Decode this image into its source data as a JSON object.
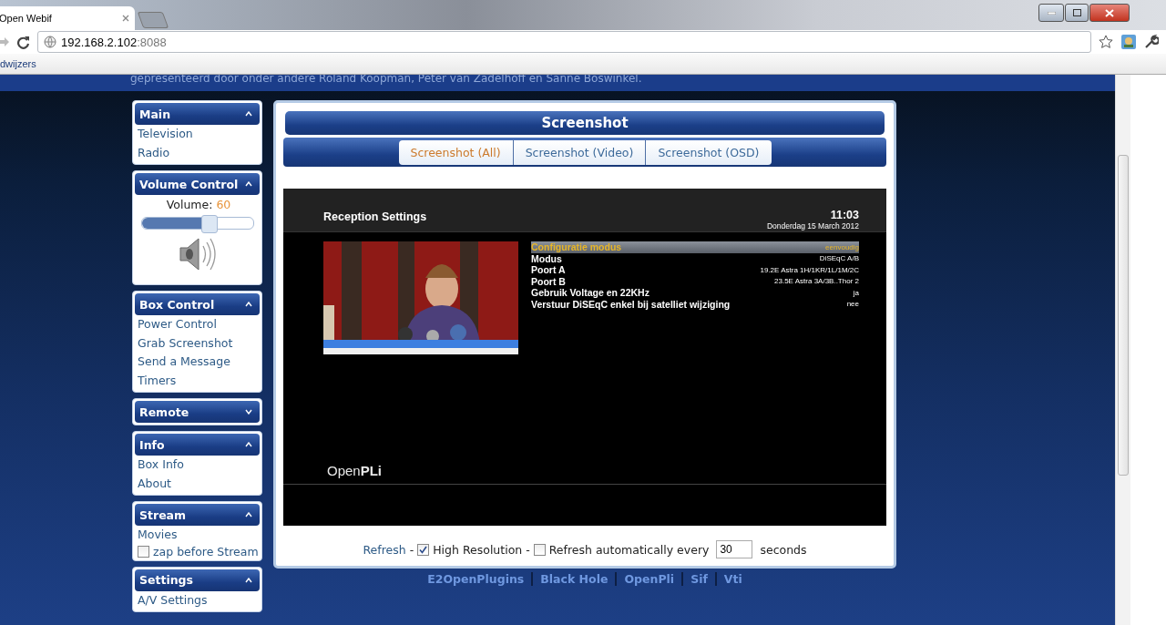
{
  "browser": {
    "tab_title": "Open Webif",
    "url_host": "192.168.2.102",
    "url_port": ":8088",
    "bookmarks_label": "dwijzers"
  },
  "banner_text": "gepresenteerd door onder andere Roland Koopman, Peter van Zadelhoff en Sanne Boswinkel.",
  "sidebar": [
    {
      "kind": "links",
      "title": "Main",
      "expanded": true,
      "items": [
        "Television",
        "Radio"
      ]
    },
    {
      "kind": "volume",
      "title": "Volume Control",
      "expanded": true,
      "volume_label": "Volume:",
      "volume_value": "60",
      "level": 0.6
    },
    {
      "kind": "links",
      "title": "Box Control",
      "expanded": true,
      "items": [
        "Power Control",
        "Grab Screenshot",
        "Send a Message",
        "Timers"
      ]
    },
    {
      "kind": "links",
      "title": "Remote",
      "expanded": false
    },
    {
      "kind": "links",
      "title": "Info",
      "expanded": true,
      "items": [
        "Box Info",
        "About"
      ]
    },
    {
      "kind": "stream",
      "title": "Stream",
      "expanded": true,
      "items": [
        "Movies"
      ],
      "checkbox": {
        "label": "zap before Stream",
        "checked": false
      }
    },
    {
      "kind": "links",
      "title": "Settings",
      "expanded": true,
      "items": [
        "A/V Settings"
      ]
    }
  ],
  "main": {
    "title": "Screenshot",
    "tabs": [
      {
        "label": "Screenshot (All)",
        "selected": true
      },
      {
        "label": "Screenshot (Video)",
        "selected": false
      },
      {
        "label": "Screenshot (OSD)",
        "selected": false
      }
    ],
    "osd": {
      "title": "Reception Settings",
      "time": "11:03",
      "date": "Donderdag 15 March 2012",
      "logo": "Open**PLi**",
      "rows": [
        {
          "label": "Configuratie modus",
          "value": "eenvoudig",
          "selected": true
        },
        {
          "label": "Modus",
          "value": "DiSEqC A/B",
          "selected": false
        },
        {
          "label": "Poort A",
          "value": "19.2E Astra 1H/1KR/1L/1M/2C",
          "selected": false
        },
        {
          "label": "Poort B",
          "value": "23.5E Astra 3A/3B..Thor 2",
          "selected": false
        },
        {
          "label": "Gebruik Voltage en 22KHz",
          "value": "ja",
          "selected": false
        },
        {
          "label": "Verstuur DiSEqC enkel bij satelliet wijziging",
          "value": "nee",
          "selected": false
        }
      ]
    },
    "controls": {
      "refresh_link": "Refresh",
      "separator_1": "-",
      "high_res": {
        "label": "High Resolution",
        "checked": true
      },
      "separator_2": "-",
      "auto_refresh": {
        "label": "Refresh automatically every",
        "checked": false
      },
      "interval": "30",
      "unit": "seconds"
    }
  },
  "footer_links": [
    "E2OpenPlugins",
    "Black Hole",
    "OpenPli",
    "Sif",
    "Vti"
  ]
}
